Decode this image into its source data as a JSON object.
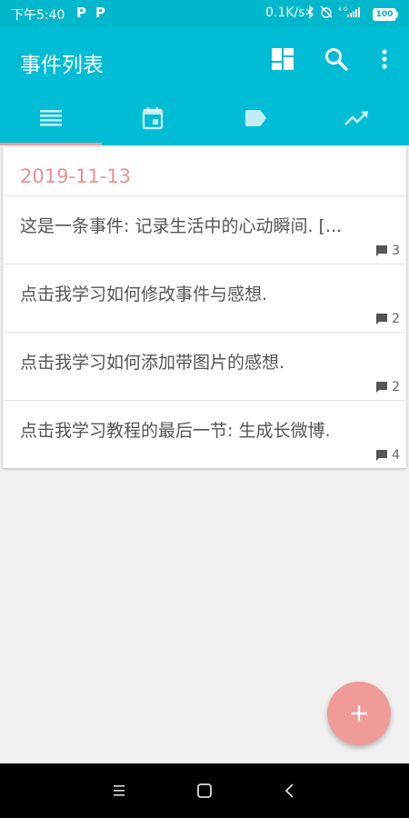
{
  "status_bar": {
    "time": "下午5:40",
    "speed": "0.1K/s",
    "battery": "100"
  },
  "app_bar": {
    "title": "事件列表"
  },
  "tabs": [
    {
      "icon": "list-icon",
      "selected": true
    },
    {
      "icon": "calendar-icon",
      "selected": false
    },
    {
      "icon": "tag-icon",
      "selected": false
    },
    {
      "icon": "trending-up-icon",
      "selected": false
    }
  ],
  "events": {
    "date": "2019-11-13",
    "items": [
      {
        "text": "这是一条事件: 记录生活中的心动瞬间. [...",
        "comments": "3"
      },
      {
        "text": "点击我学习如何修改事件与感想.",
        "comments": "2"
      },
      {
        "text": "点击我学习如何添加带图片的感想.",
        "comments": "2"
      },
      {
        "text": "点击我学习教程的最后一节: 生成长微博.",
        "comments": "4"
      }
    ]
  },
  "fab": {
    "icon": "add-icon"
  },
  "colors": {
    "primary": "#00bcd4",
    "status_bar": "#00b7cc",
    "accent": "#f09a9a",
    "date_text": "#ef8f8f"
  }
}
